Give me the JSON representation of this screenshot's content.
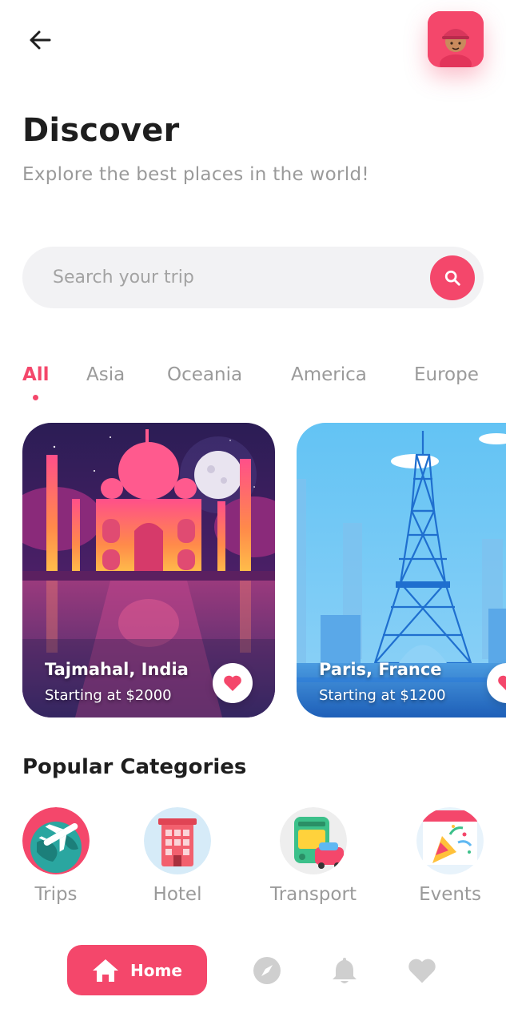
{
  "header": {
    "title": "Discover",
    "subtitle": "Explore the best places in the world!"
  },
  "search": {
    "placeholder": "Search your trip"
  },
  "tabs": [
    {
      "label": "All",
      "active": true
    },
    {
      "label": "Asia",
      "active": false
    },
    {
      "label": "Oceania",
      "active": false
    },
    {
      "label": "America",
      "active": false
    },
    {
      "label": "Europe",
      "active": false
    }
  ],
  "places": [
    {
      "name": "Tajmahal, India",
      "price": "Starting at $2000",
      "favorite": true
    },
    {
      "name": "Paris, France",
      "price": "Starting at $1200",
      "favorite": true
    }
  ],
  "categories_title": "Popular Categories",
  "categories": [
    {
      "label": "Trips",
      "icon": "airplane-globe-icon"
    },
    {
      "label": "Hotel",
      "icon": "hotel-icon"
    },
    {
      "label": "Transport",
      "icon": "bus-car-icon"
    },
    {
      "label": "Events",
      "icon": "party-popper-icon"
    }
  ],
  "nav": {
    "home_label": "Home",
    "items": [
      "home-icon",
      "compass-icon",
      "bell-icon",
      "heart-icon"
    ]
  },
  "colors": {
    "accent": "#f4476b",
    "text_primary": "#1e1e1e",
    "text_muted": "#9a9a9a",
    "search_bg": "#f2f2f4",
    "nav_inactive": "#cfcfcf"
  }
}
